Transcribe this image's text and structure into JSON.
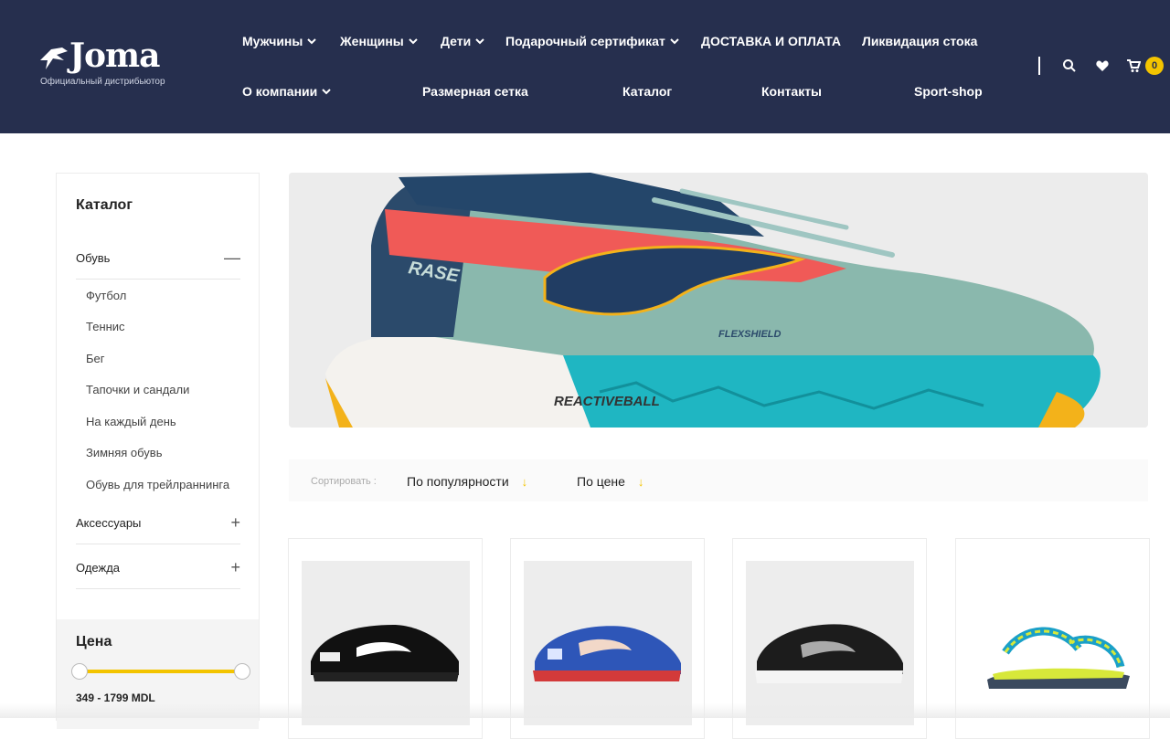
{
  "brand": {
    "name": "Joma",
    "subtitle": "Официальный дистрибьютор"
  },
  "nav": {
    "row1": [
      "Мужчины",
      "Женщины",
      "Дети",
      "Подарочный сертификат",
      "ДОСТАВКА И ОПЛАТА",
      "Ликвидация стока"
    ],
    "row2": [
      "О компании",
      "Размерная сетка",
      "Каталог",
      "Контакты",
      "Sport-shop"
    ]
  },
  "header_icons": [
    "search-icon",
    "heart-icon",
    "cart-icon"
  ],
  "cart": {
    "count": "0"
  },
  "colors": {
    "header_bg": "#262f4e",
    "accent": "#f3c400"
  },
  "sidebar": {
    "title": "Каталог",
    "categories": [
      {
        "label": "Обувь",
        "state": "—",
        "items": [
          "Футбол",
          "Теннис",
          "Бег",
          "Тапочки и сандали",
          "На каждый день",
          "Зимняя обувь",
          "Обувь для трейлраннинга"
        ]
      },
      {
        "label": "Аксессуары",
        "state": "+"
      },
      {
        "label": "Одежда",
        "state": "+"
      }
    ]
  },
  "price_filter": {
    "title": "Цена",
    "range_text": "349 - 1799 MDL",
    "min": 349,
    "max": 1799
  },
  "banner": {
    "shoe_texts": [
      "RASE",
      "FLEXSHIELD",
      "REACTIVEBALL"
    ]
  },
  "sort": {
    "label": "Сортировать :",
    "options": [
      "По популярности",
      "По цене"
    ],
    "arrow": "↓"
  },
  "products": [
    {
      "name": "football-boot-black"
    },
    {
      "name": "tennis-shoe-blue"
    },
    {
      "name": "running-shoe-black"
    },
    {
      "name": "sandal-navy-yellow"
    }
  ]
}
